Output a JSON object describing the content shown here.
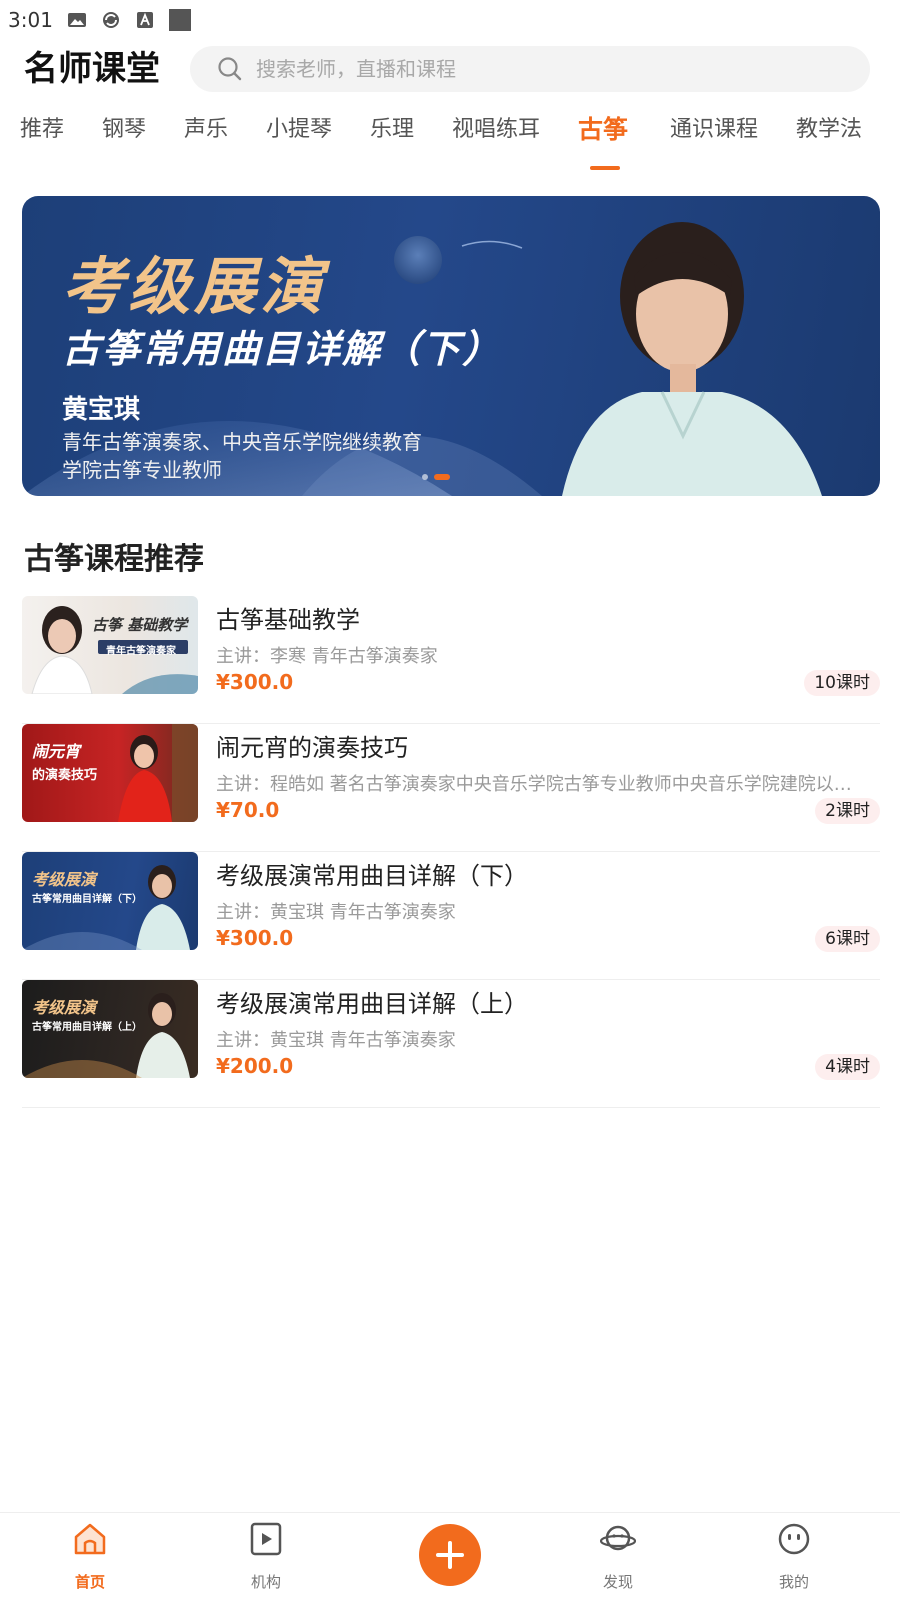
{
  "status_bar": {
    "time": "3:01"
  },
  "header": {
    "title": "名师课堂",
    "search_placeholder": "搜索老师，直播和课程"
  },
  "tabs": [
    {
      "label": "推荐",
      "active": false
    },
    {
      "label": "钢琴",
      "active": false
    },
    {
      "label": "声乐",
      "active": false
    },
    {
      "label": "小提琴",
      "active": false
    },
    {
      "label": "乐理",
      "active": false
    },
    {
      "label": "视唱练耳",
      "active": false
    },
    {
      "label": "古筝",
      "active": true
    },
    {
      "label": "通识课程",
      "active": false
    },
    {
      "label": "教学法",
      "active": false
    }
  ],
  "banner": {
    "headline": "考级展演",
    "subtitle": "古筝常用曲目详解（下）",
    "teacher_name": "黄宝琪",
    "teacher_desc_line1": "青年古筝演奏家、中央音乐学院继续教育",
    "teacher_desc_line2": "学院古筝专业教师",
    "slide_count": 2,
    "active_slide": 2
  },
  "section": {
    "title": "古筝课程推荐"
  },
  "courses": [
    {
      "title": "古筝基础教学",
      "lecturer": "主讲：李寒 青年古筝演奏家",
      "price": "¥300.0",
      "lessons": "10课时",
      "thumb_caption": "古筝 基础教学",
      "thumb_caption2": "青年古筝演奏家"
    },
    {
      "title": "闹元宵的演奏技巧",
      "lecturer": "主讲：程皓如 著名古筝演奏家中央音乐学院古筝专业教师中央音乐学院建院以来…",
      "price": "¥70.0",
      "lessons": "2课时",
      "thumb_caption": "闹元宵",
      "thumb_caption2": "的演奏技巧"
    },
    {
      "title": "考级展演常用曲目详解（下）",
      "lecturer": "主讲：黄宝琪 青年古筝演奏家",
      "price": "¥300.0",
      "lessons": "6课时",
      "thumb_caption": "考级展演",
      "thumb_caption2": "古筝常用曲目详解（下）"
    },
    {
      "title": "考级展演常用曲目详解（上）",
      "lecturer": "主讲：黄宝琪 青年古筝演奏家",
      "price": "¥200.0",
      "lessons": "4课时",
      "thumb_caption": "考级展演",
      "thumb_caption2": "古筝常用曲目详解（上）"
    }
  ],
  "bottom_nav": [
    {
      "label": "首页",
      "icon": "home-icon",
      "active": true
    },
    {
      "label": "机构",
      "icon": "video-icon",
      "active": false
    },
    {
      "label": "发现",
      "icon": "planet-icon",
      "active": false
    },
    {
      "label": "我的",
      "icon": "profile-face-icon",
      "active": false
    }
  ],
  "colors": {
    "accent": "#f26b1d",
    "banner_bg": "#24488a",
    "badge_bg": "#fdeeee"
  }
}
